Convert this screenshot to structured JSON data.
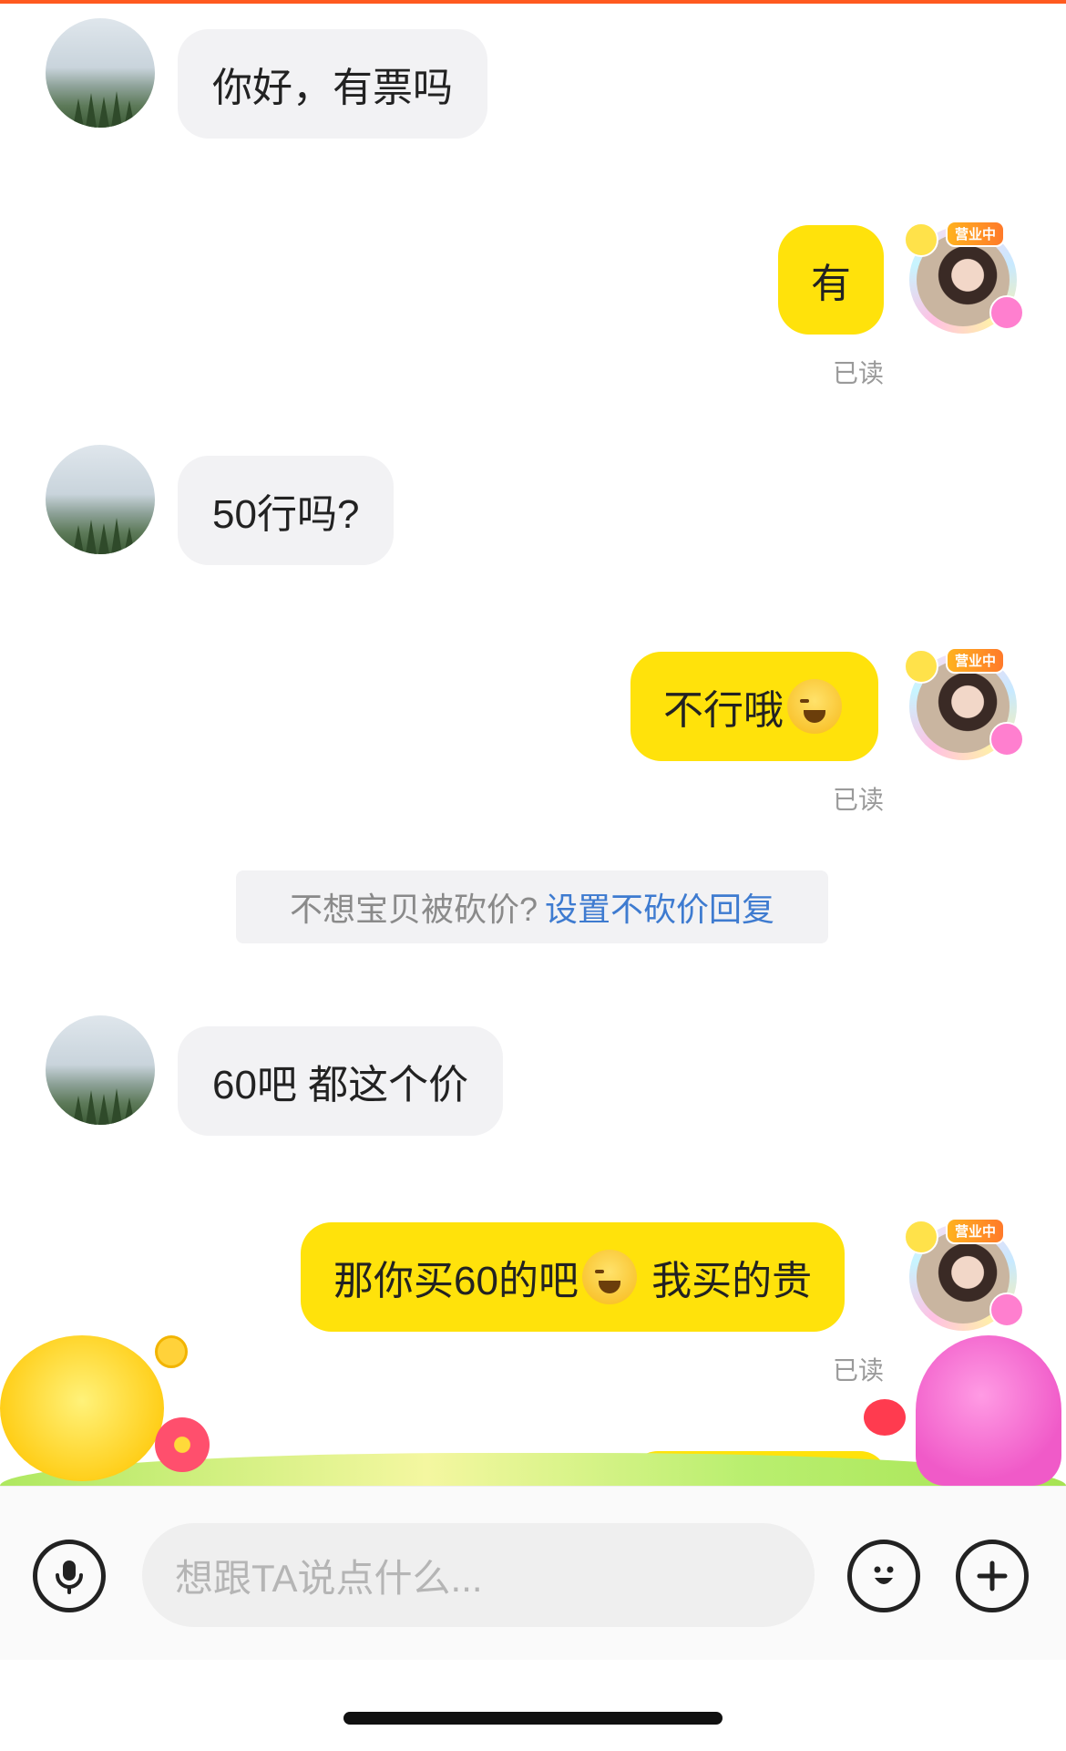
{
  "messages": [
    {
      "side": "in",
      "text": "你好，有票吗"
    },
    {
      "side": "out",
      "text": "有",
      "status": "已读"
    },
    {
      "side": "in",
      "text": "50行吗?"
    },
    {
      "side": "out",
      "text": "不行哦",
      "emoji": "crying-laugh-emoji",
      "status": "已读"
    },
    {
      "side": "in",
      "text": "60吧 都这个价"
    },
    {
      "side": "out",
      "text_before": "那你买60的吧",
      "emoji": "crying-laugh-emoji",
      "text_after": " 我买的贵",
      "status": "已读"
    }
  ],
  "seller_badge": "营业中",
  "notice": {
    "text": "不想宝贝被砍价?",
    "link": "设置不砍价回复"
  },
  "input": {
    "placeholder": "想跟TA说点什么..."
  },
  "icons": {
    "voice": "microphone-icon",
    "emoji": "smiley-icon",
    "more": "plus-icon"
  },
  "colors": {
    "accent_bubble": "#ffe20b",
    "incoming_bubble": "#f2f2f4",
    "link": "#3e7bd0",
    "top_line": "#ff5a1f"
  }
}
